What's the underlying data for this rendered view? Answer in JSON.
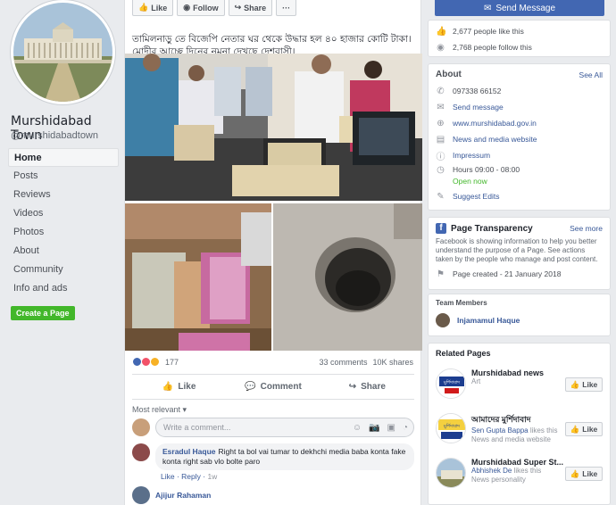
{
  "page": {
    "name": "Murshidabad Town",
    "handle": "@murshidabadtown",
    "nav": [
      "Home",
      "Posts",
      "Reviews",
      "Videos",
      "Photos",
      "About",
      "Community",
      "Info and ads"
    ],
    "create_page": "Create a Page"
  },
  "post": {
    "top_actions": [
      "Like",
      "Follow",
      "Share",
      "···"
    ],
    "text": "তামিলনাড়ু তে বিজেপি নেতার ঘর থেকে উদ্ধার হল ৪০ হাজার কোটি টাকা। মোদীর আচ্ছে দিনের নমুনা দেখছে দেশবাসী।",
    "reaction_count": "177",
    "comments": "33 comments",
    "shares": "10K shares",
    "actions": [
      "Like",
      "Comment",
      "Share"
    ],
    "sort": "Most relevant ▾",
    "comment_placeholder": "Write a comment...",
    "comment1": {
      "author": "Esradul Haque",
      "text": "Right ta bol vai tumar to dekhchi media baba konta fake konta right sab vlo bolte paro",
      "like": "Like",
      "reply": "Reply",
      "time": "1w"
    },
    "comment2_author": "Ajijur Rahaman"
  },
  "sidebar": {
    "send_message": "Send Message",
    "likes": "2,677 people like this",
    "follows": "2,768 people follow this",
    "about": {
      "title": "About",
      "see_all": "See All",
      "phone": "097338 66152",
      "send_message": "Send message",
      "website": "www.murshidabad.gov.in",
      "category": "News and media website",
      "impressum": "Impressum",
      "hours": "Hours 09:00 - 08:00",
      "open": "Open now",
      "suggest": "Suggest Edits"
    },
    "transparency": {
      "title": "Page Transparency",
      "see_more": "See more",
      "text": "Facebook is showing information to help you better understand the purpose of a Page. See actions taken by the people who manage and post content.",
      "created": "Page created - 21 January 2018"
    },
    "team": {
      "title": "Team Members",
      "member": "Injamamul Haque"
    },
    "related": {
      "title": "Related Pages",
      "items": [
        {
          "name": "Murshidabad news",
          "sub1": "Art",
          "sub1_link": "",
          "sub2": "",
          "logo_text": "মুর্শিদাবাদ"
        },
        {
          "name": "আমাদের মুর্শিদাবাদ",
          "sub1_link": "Sen Gupta Bappa",
          "sub1": "likes this",
          "sub2": "News and media website",
          "logo_text": "মুর্শিদাবাদ"
        },
        {
          "name": "Murshidabad Super St...",
          "sub1_link": "Abhishek De",
          "sub1": "likes this",
          "sub2": "News personality",
          "logo_text": ""
        }
      ],
      "like": "Like"
    }
  },
  "colors": {
    "fb_blue": "#4267b2",
    "link": "#385898",
    "green": "#42b72a",
    "bg": "#e9ebee"
  }
}
